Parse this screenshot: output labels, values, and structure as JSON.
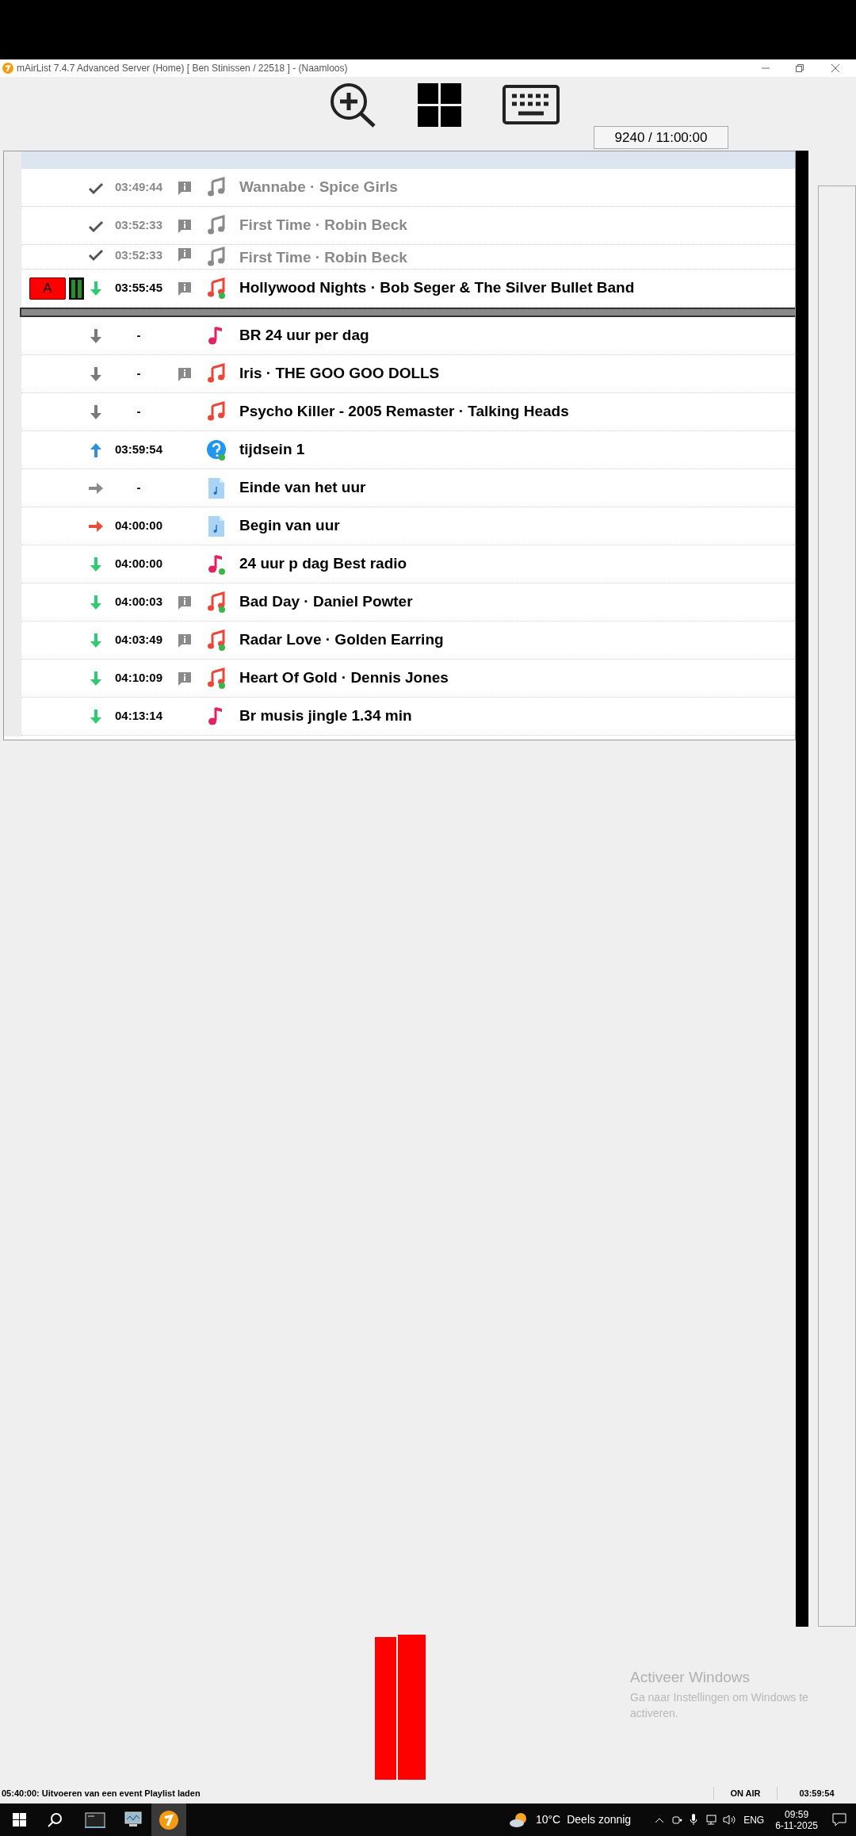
{
  "window": {
    "title": "mAirList 7.4.7 Advanced Server (Home) [ Ben Stinissen / 22518 ] - (Naamloos)"
  },
  "counter": "9240 / 11:00:00",
  "playlist": [
    {
      "kind": "music",
      "marker": {
        "kind": "check",
        "color": "#555555"
      },
      "time": "03:49:44",
      "info": true,
      "ready": false,
      "played": true,
      "title": "Wannabe · Spice Girls"
    },
    {
      "kind": "music",
      "marker": {
        "kind": "check",
        "color": "#555555"
      },
      "time": "03:52:33",
      "info": true,
      "ready": false,
      "played": true,
      "title": "First Time · Robin Beck"
    },
    {
      "kind": "music",
      "marker": {
        "kind": "check",
        "color": "#555555"
      },
      "time": "03:52:33",
      "info": true,
      "ready": false,
      "played": true,
      "title": "First Time · Robin Beck"
    },
    {
      "kind": "music",
      "player": "A",
      "level": 1,
      "marker": {
        "kind": "down",
        "color": "#2ecc71"
      },
      "time": "03:55:45",
      "info": true,
      "ready": true,
      "played": false,
      "title": "Hollywood Nights · Bob Seger & The Silver Bullet Band"
    },
    {
      "kind": "jingle",
      "marker": {
        "kind": "down",
        "color": "#7a7a7a"
      },
      "time": "-",
      "info": false,
      "ready": false,
      "played": false,
      "title": "BR 24 uur per dag"
    },
    {
      "kind": "music",
      "marker": {
        "kind": "down",
        "color": "#7a7a7a"
      },
      "time": "-",
      "info": true,
      "ready": false,
      "played": false,
      "title": "Iris · THE GOO GOO DOLLS"
    },
    {
      "kind": "music",
      "marker": {
        "kind": "down",
        "color": "#7a7a7a"
      },
      "time": "-",
      "info": false,
      "ready": false,
      "played": false,
      "title": "Psycho Killer - 2005 Remaster · Talking Heads"
    },
    {
      "kind": "unknown",
      "marker": {
        "kind": "up",
        "color": "#2f8fdc"
      },
      "time": "03:59:54",
      "info": false,
      "ready": true,
      "played": false,
      "title": "tijdsein 1"
    },
    {
      "kind": "file",
      "marker": {
        "kind": "right",
        "color": "#8a8a8a"
      },
      "time": "-",
      "info": false,
      "ready": false,
      "played": false,
      "title": "Einde van het uur"
    },
    {
      "kind": "file",
      "marker": {
        "kind": "right",
        "color": "#e74c3c"
      },
      "time": "04:00:00",
      "info": false,
      "ready": false,
      "played": false,
      "title": "Begin van uur"
    },
    {
      "kind": "jingle",
      "marker": {
        "kind": "down",
        "color": "#2ecc71"
      },
      "time": "04:00:00",
      "info": false,
      "ready": true,
      "played": false,
      "title": "24 uur p dag Best radio"
    },
    {
      "kind": "music",
      "marker": {
        "kind": "down",
        "color": "#2ecc71"
      },
      "time": "04:00:03",
      "info": true,
      "ready": true,
      "played": false,
      "title": "Bad Day · Daniel Powter"
    },
    {
      "kind": "music",
      "marker": {
        "kind": "down",
        "color": "#2ecc71"
      },
      "time": "04:03:49",
      "info": true,
      "ready": true,
      "played": false,
      "title": "Radar Love · Golden Earring"
    },
    {
      "kind": "music",
      "marker": {
        "kind": "down",
        "color": "#2ecc71"
      },
      "time": "04:10:09",
      "info": true,
      "ready": true,
      "played": false,
      "title": "Heart Of Gold · Dennis Jones"
    },
    {
      "kind": "jingle",
      "marker": {
        "kind": "down",
        "color": "#2ecc71"
      },
      "time": "04:13:14",
      "info": false,
      "ready": false,
      "played": false,
      "title": "Br musis jingle 1.34 min"
    }
  ],
  "activation": {
    "title": "Activeer Windows",
    "text": "Ga naar Instellingen om Windows te activeren."
  },
  "status_bar": {
    "message": "05:40:00: Uitvoeren van een event Playlist laden",
    "state": "ON AIR",
    "time": "03:59:54"
  },
  "taskbar": {
    "temperature": "10°C",
    "weather": "Deels zonnig",
    "language": "ENG",
    "time": "09:59",
    "date": "6-11-2025"
  }
}
